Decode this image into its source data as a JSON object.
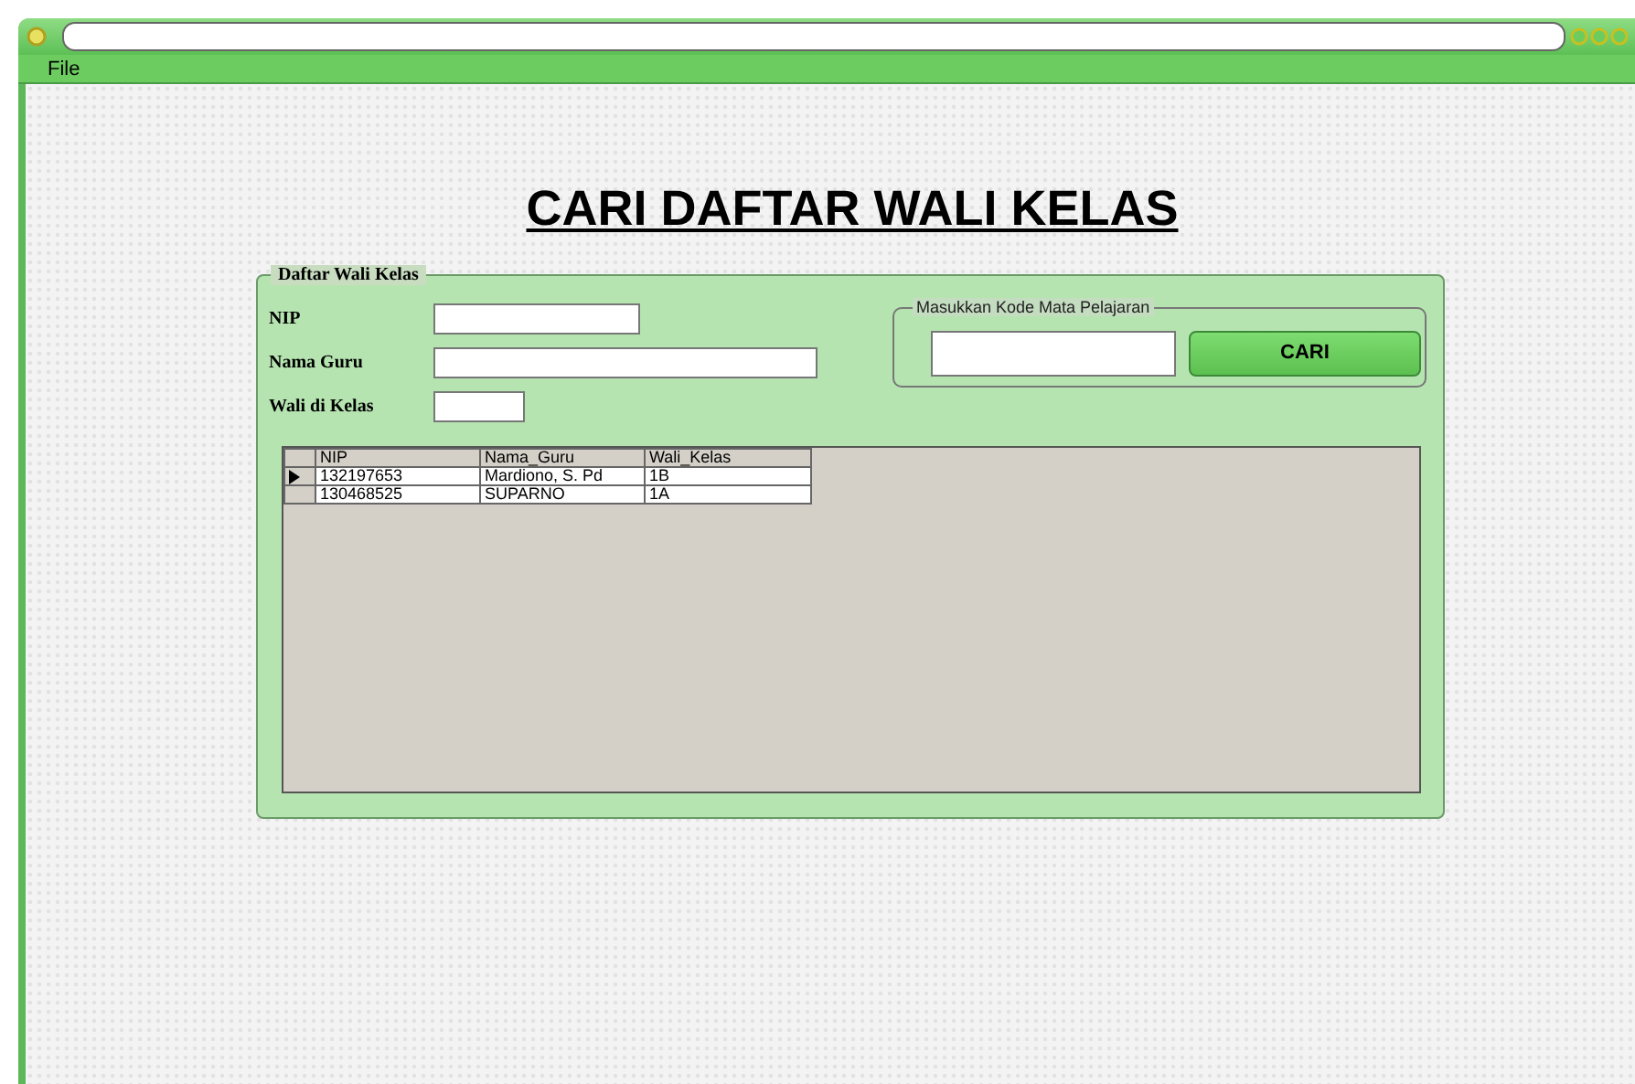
{
  "menu": [
    {
      "label": "File"
    }
  ],
  "heading": "CARI DAFTAR WALI KELAS",
  "group": {
    "legend": "Daftar Wali Kelas",
    "fields": [
      {
        "label": "NIP"
      },
      {
        "label": "Nama Guru"
      },
      {
        "label": "Wali di Kelas"
      }
    ]
  },
  "search": {
    "legend": "Masukkan Kode Mata Pelajaran",
    "button": "CARI"
  },
  "table": {
    "columns": [
      "NIP",
      "Nama_Guru",
      "Wali_Kelas"
    ],
    "rows": [
      {
        "cells": [
          "132197653",
          "Mardiono, S. Pd",
          "1B"
        ],
        "current": true
      },
      {
        "cells": [
          "130468525",
          "SUPARNO",
          "1A"
        ],
        "current": false
      }
    ]
  }
}
